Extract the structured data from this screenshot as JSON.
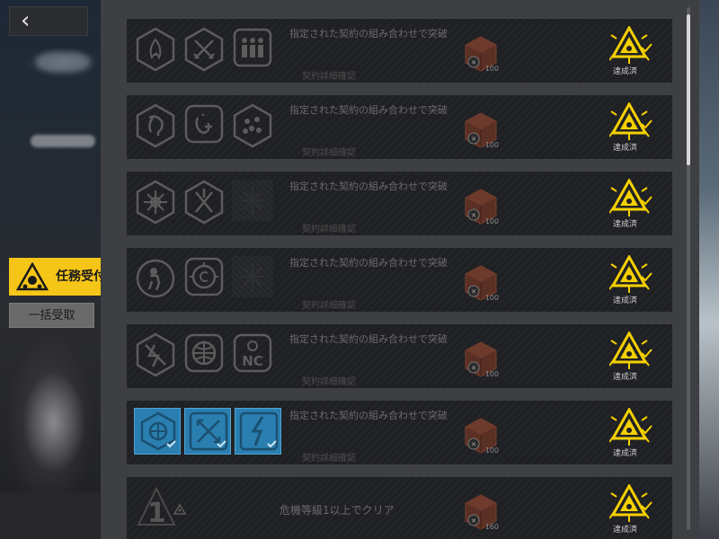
{
  "nav": {
    "back_icon": "chevron-left-icon",
    "back_glyph": "‹"
  },
  "sidebar": {
    "task_tab_label": "任務受付",
    "collect_all_label": "一括受取",
    "accent": "#f5c518"
  },
  "missions": [
    {
      "description": "指定された契約の組み合わせで突破",
      "detail": "契約詳細確認",
      "reward_qty": "100",
      "status": "達成済",
      "icons": [
        "fire-contract-icon",
        "crossed-swords-icon",
        "squad-grid-icon"
      ]
    },
    {
      "description": "指定された契約の組み合わせで突破",
      "detail": "契約詳細確認",
      "reward_qty": "100",
      "status": "達成済",
      "icons": [
        "creature-contract-icon",
        "cost-plus-icon",
        "swarm-contract-icon"
      ]
    },
    {
      "description": "指定された契約の組み合わせで突破",
      "detail": "契約詳細確認",
      "reward_qty": "100",
      "status": "達成済",
      "icons": [
        "compass-burst-icon",
        "blade-cross-icon",
        "locked-slot-icon"
      ]
    },
    {
      "description": "指定された契約の組み合わせで突破",
      "detail": "契約詳細確認",
      "reward_qty": "100",
      "status": "達成済",
      "icons": [
        "operator-silhouette-icon",
        "target-copyright-icon",
        "locked-slot-icon"
      ]
    },
    {
      "description": "指定された契約の組み合わせで突破",
      "detail": "契約詳細確認",
      "reward_qty": "100",
      "status": "達成済",
      "icons": [
        "broken-shield-icon",
        "globe-grid-icon",
        "nc-contract-icon"
      ]
    },
    {
      "description": "指定された契約の組み合わせで突破",
      "detail": "契約詳細確認",
      "reward_qty": "100",
      "status": "達成済",
      "icons": [
        "crosshair-globe-icon",
        "arrows-converge-icon",
        "lightning-slash-icon"
      ]
    },
    {
      "description": "危機等級1以上でクリア",
      "detail": "",
      "reward_qty": "160",
      "status": "達成済",
      "rank": "1",
      "icons": [
        "danger-rank-icon"
      ]
    }
  ]
}
